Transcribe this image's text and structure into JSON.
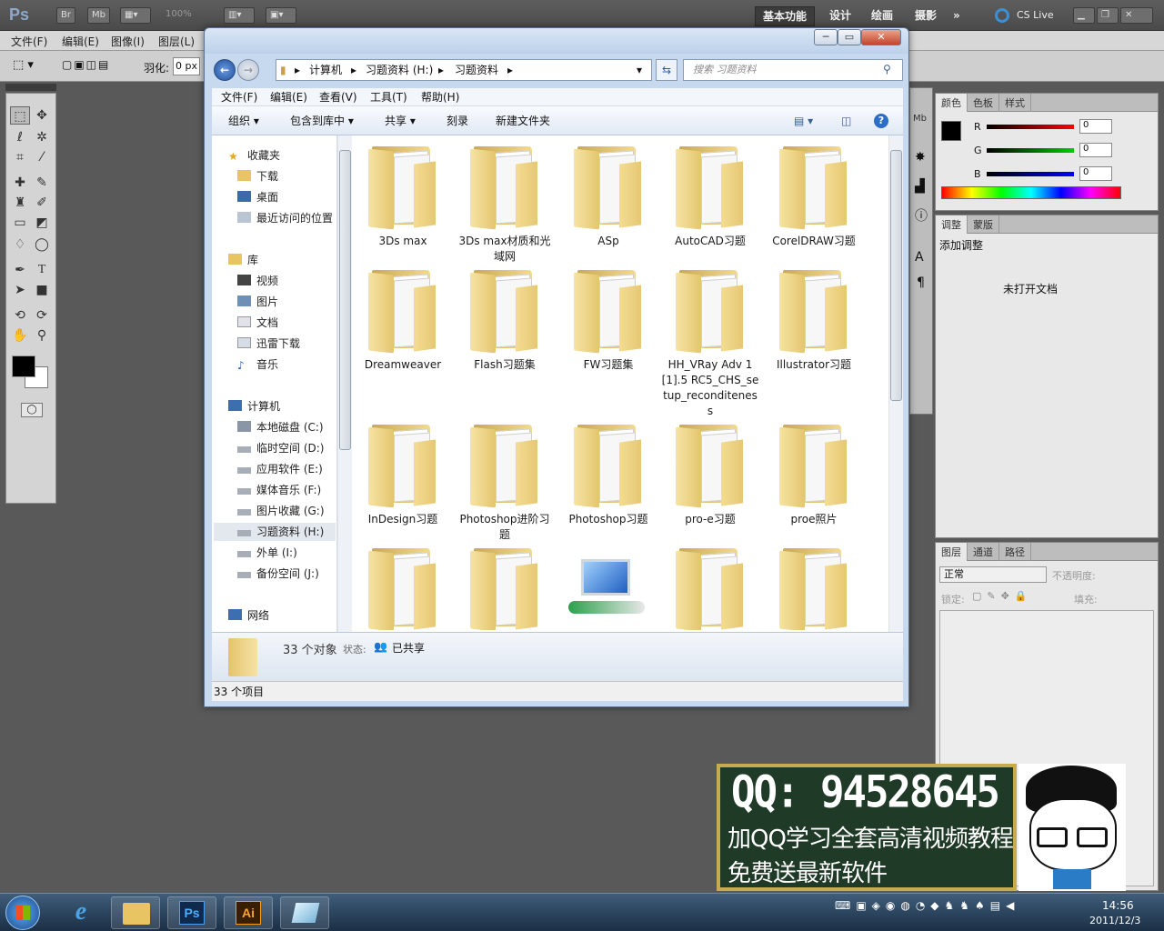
{
  "photoshop": {
    "logo": "Ps",
    "appbar_buttons": [
      "Br",
      "Mb"
    ],
    "zoom": "100%",
    "workspaces": [
      "基本功能",
      "设计",
      "绘画",
      "摄影"
    ],
    "active_workspace": "基本功能",
    "more": "»",
    "cs_live": "CS Live",
    "menu": [
      "文件(F)",
      "编辑(E)",
      "图像(I)",
      "图层(L)"
    ],
    "feather_label": "羽化:",
    "feather_value": "0 px",
    "color_panel": {
      "tabs": [
        "颜色",
        "色板",
        "样式"
      ],
      "channels": [
        {
          "label": "R",
          "value": "0"
        },
        {
          "label": "G",
          "value": "0"
        },
        {
          "label": "B",
          "value": "0"
        }
      ]
    },
    "adjust_panel": {
      "tabs": [
        "调整",
        "蒙版"
      ],
      "title": "添加调整",
      "empty_msg": "未打开文档"
    },
    "layers_panel": {
      "tabs": [
        "图层",
        "通道",
        "路径"
      ],
      "blend_mode": "正常",
      "opacity_label": "不透明度:",
      "lock_label": "锁定:",
      "fill_label": "填充:"
    }
  },
  "explorer": {
    "breadcrumb": [
      "计算机",
      "习题资料 (H:)",
      "习题资料"
    ],
    "search_placeholder": "搜索 习题资料",
    "menu": [
      "文件(F)",
      "编辑(E)",
      "查看(V)",
      "工具(T)",
      "帮助(H)"
    ],
    "commands": [
      "组织",
      "包含到库中",
      "共享",
      "刻录",
      "新建文件夹"
    ],
    "nav": {
      "favorites": {
        "label": "收藏夹",
        "items": [
          "下载",
          "桌面",
          "最近访问的位置"
        ]
      },
      "libraries": {
        "label": "库",
        "items": [
          "视频",
          "图片",
          "文档",
          "迅雷下载",
          "音乐"
        ]
      },
      "computer": {
        "label": "计算机",
        "items": [
          "本地磁盘 (C:)",
          "临时空间 (D:)",
          "应用软件 (E:)",
          "媒体音乐 (F:)",
          "图片收藏 (G:)",
          "习题资料 (H:)",
          "外单 (I:)",
          "备份空间 (J:)"
        ],
        "selected": "习题资料 (H:)"
      },
      "network": {
        "label": "网络"
      }
    },
    "folders": [
      "3Ds max",
      "3Ds max材质和光域网",
      "ASp",
      "AutoCAD习题",
      "CorelDRAW习题",
      "Dreamweaver",
      "Flash习题集",
      "FW习题集",
      "HH_VRay Adv 1[1].5 RC5_CHS_setup_reconditeness",
      "Illustrator习题",
      "InDesign习题",
      "Photoshop进阶习题",
      "Photoshop习题",
      "pro-e习题",
      "proe照片",
      "",
      "",
      "",
      "",
      ""
    ],
    "details": {
      "count": "33 个对象",
      "state_label": "状态:",
      "state_value": "已共享"
    },
    "status": "33 个项目"
  },
  "banner": {
    "qq": "QQ: 94528645",
    "line1": "加QQ学习全套高清视频教程",
    "line2": "免费送最新软件"
  },
  "taskbar": {
    "clock_time": "14:56",
    "clock_date": "2011/12/3",
    "apps": [
      "ie-icon",
      "explorer-icon",
      "photoshop-icon",
      "illustrator-icon",
      "app-icon"
    ]
  },
  "colors": {
    "ps_dark": "#595959",
    "explorer_frame": "#c7d9ef",
    "folder": "#f2da8e",
    "accent": "#2b5ea8"
  }
}
